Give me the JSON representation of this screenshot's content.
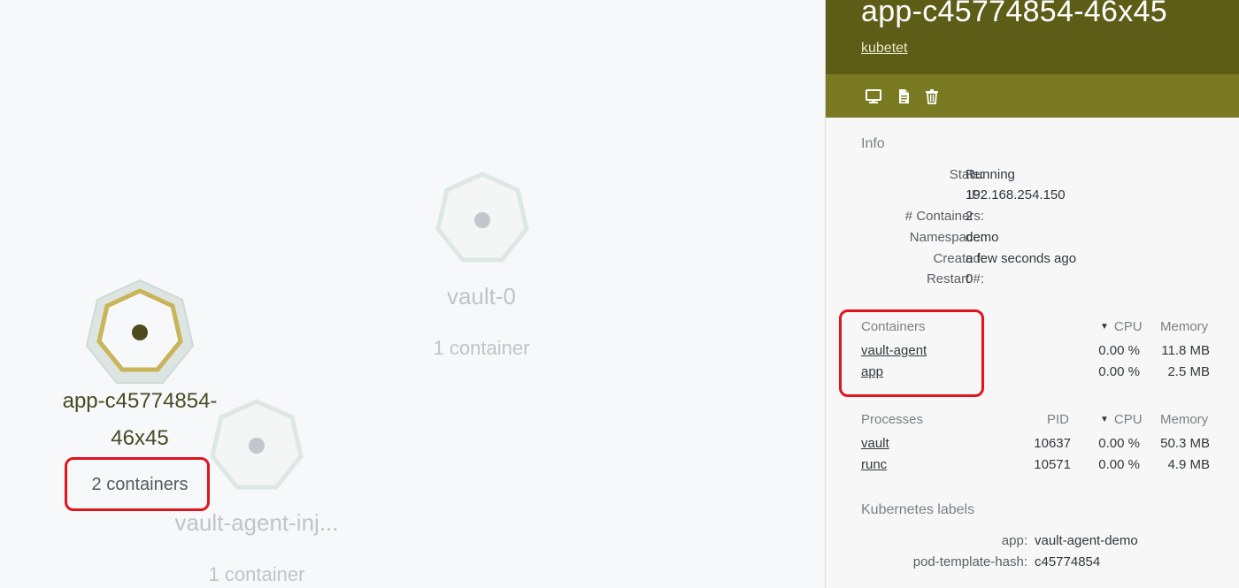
{
  "nodes": {
    "app": {
      "name_line1": "app-c45774854-",
      "name_line2": "46x45",
      "subtitle": "2 containers"
    },
    "vault0": {
      "name": "vault-0",
      "subtitle": "1 container"
    },
    "injector": {
      "name": "vault-agent-inj...",
      "subtitle": "1 container"
    }
  },
  "panel": {
    "title": "app-c45774854-46x45",
    "subtitle_link": "kubetet",
    "toolbar": {
      "icons": [
        "monitor-icon",
        "document-icon",
        "trash-icon"
      ]
    },
    "info": {
      "heading": "Info",
      "rows": [
        {
          "key": "State:",
          "value": "Running"
        },
        {
          "key": "IP:",
          "value": "192.168.254.150"
        },
        {
          "key": "# Containers:",
          "value": "2"
        },
        {
          "key": "Namespace:",
          "value": "demo"
        },
        {
          "key": "Created:",
          "value": "a few seconds ago"
        },
        {
          "key": "Restart #:",
          "value": "0"
        }
      ]
    },
    "containers": {
      "heading": "Containers",
      "cpu_header": "CPU",
      "memory_header": "Memory",
      "rows": [
        {
          "name": "vault-agent",
          "cpu": "0.00 %",
          "memory": "11.8 MB"
        },
        {
          "name": "app",
          "cpu": "0.00 %",
          "memory": "2.5 MB"
        }
      ]
    },
    "processes": {
      "heading": "Processes",
      "pid_header": "PID",
      "cpu_header": "CPU",
      "memory_header": "Memory",
      "rows": [
        {
          "name": "vault",
          "pid": "10637",
          "cpu": "0.00 %",
          "memory": "50.3 MB"
        },
        {
          "name": "runc",
          "pid": "10571",
          "cpu": "0.00 %",
          "memory": "4.9 MB"
        }
      ]
    },
    "labels": {
      "heading": "Kubernetes labels",
      "rows": [
        {
          "key": "app:",
          "value": "vault-agent-demo"
        },
        {
          "key": "pod-template-hash:",
          "value": "c45774854"
        }
      ]
    }
  },
  "colors": {
    "header_bg": "#5d5d18",
    "toolbar_bg": "#7a7a22",
    "highlight": "#e0141e",
    "selected_ring": "#c9b45a"
  }
}
